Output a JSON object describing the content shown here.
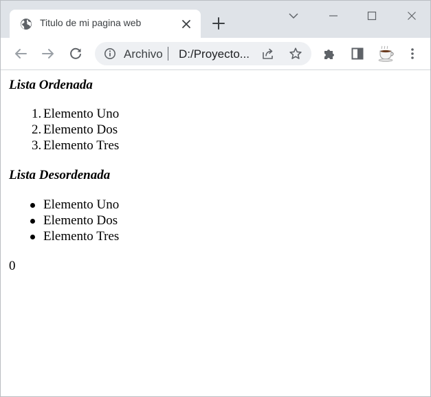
{
  "tab": {
    "title": "Titulo de mi pagina web"
  },
  "omnibox": {
    "scheme_label": "Archivo",
    "url": "D:/Proyecto..."
  },
  "page": {
    "ordered_heading": "Lista Ordenada",
    "ordered_items": [
      "Elemento Uno",
      "Elemento Dos",
      "Elemento Tres"
    ],
    "ordered_markers": [
      "1.",
      "2.",
      "3."
    ],
    "unordered_heading": "Lista Desordenada",
    "unordered_items": [
      "Elemento Uno",
      "Elemento Dos",
      "Elemento Tres"
    ],
    "footer_value": "0"
  },
  "icons": {
    "favicon": "globe-icon",
    "tab_close": "close-icon",
    "new_tab": "plus-icon",
    "tab_search": "chevron-down-icon",
    "minimize": "minimize-icon",
    "maximize": "maximize-icon",
    "close_window": "close-icon",
    "back": "back-arrow-icon",
    "forward": "forward-arrow-icon",
    "reload": "reload-icon",
    "site_info": "info-icon",
    "share": "share-icon",
    "bookmark": "star-icon",
    "extensions": "puzzle-icon",
    "side_panel": "side-panel-icon",
    "profile": "coffee-cup-icon",
    "menu": "kebab-menu-icon"
  },
  "colors": {
    "tabstrip_bg": "#dfe3e8",
    "omnibox_bg": "#eef0f3",
    "icon_gray": "#5f6368",
    "disabled_icon": "#9aa0a6"
  }
}
